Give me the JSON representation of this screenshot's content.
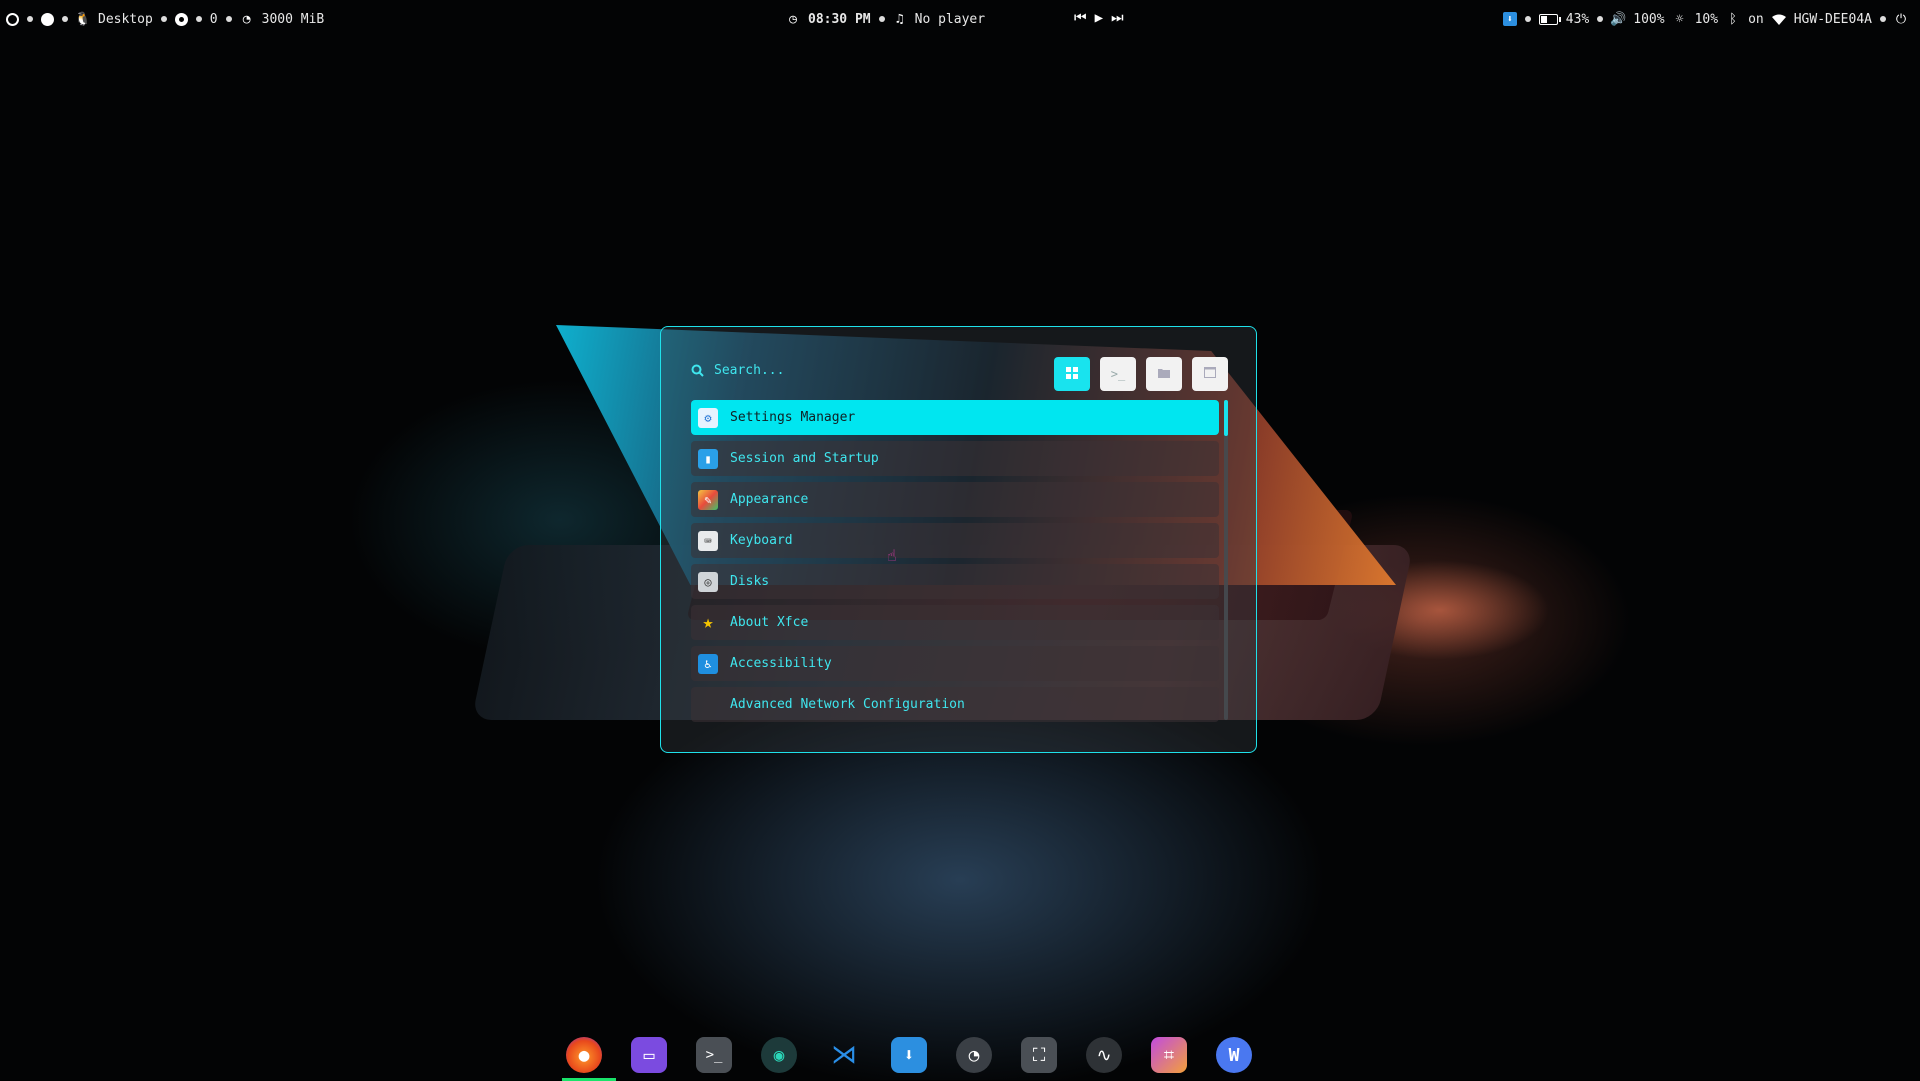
{
  "topbar": {
    "workspace_label": "Desktop",
    "window_count": "0",
    "memory": "3000 MiB",
    "clock": "08:30 PM",
    "player": "No player",
    "battery": "43%",
    "volume": "100%",
    "brightness": "10%",
    "bluetooth": "on",
    "network": "HGW-DEE04A"
  },
  "launcher": {
    "search_placeholder": "Search...",
    "modes": [
      "grid-icon",
      "terminal-icon",
      "folder-icon",
      "window-icon"
    ],
    "active_mode": "grid-icon",
    "items": [
      {
        "label": "Settings Manager",
        "icon": "settings-icon",
        "selected": true
      },
      {
        "label": "Session and Startup",
        "icon": "session-icon"
      },
      {
        "label": "Appearance",
        "icon": "appearance-icon"
      },
      {
        "label": "Keyboard",
        "icon": "keyboard-icon"
      },
      {
        "label": "Disks",
        "icon": "disks-icon"
      },
      {
        "label": "About Xfce",
        "icon": "star-icon"
      },
      {
        "label": "Accessibility",
        "icon": "accessibility-icon"
      },
      {
        "label": "Advanced Network Configuration",
        "icon": ""
      }
    ]
  },
  "dock": {
    "apps": [
      "firefox",
      "files",
      "terminal",
      "obs",
      "vscode",
      "downloader",
      "timer",
      "screenshot",
      "audacity",
      "crop",
      "wps"
    ],
    "active": "firefox"
  },
  "colors": {
    "accent": "#19e3ee",
    "selected_bg": "#00e6f0",
    "dock_indicator": "#19e36a"
  }
}
